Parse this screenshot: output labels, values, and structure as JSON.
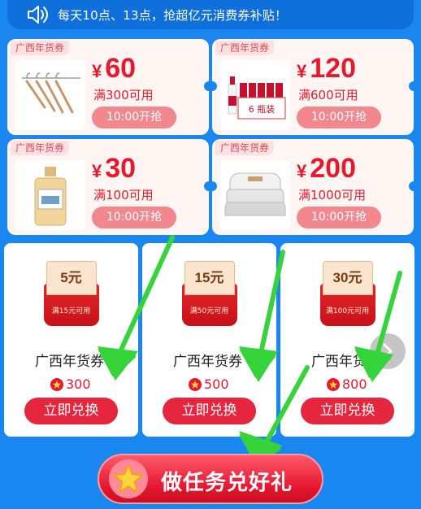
{
  "notice": {
    "icon": "speaker-icon",
    "text": "每天10点、13点，抢超亿元消费券补贴！"
  },
  "coupons": [
    {
      "tag": "广西年货券",
      "currency": "¥",
      "amount": "60",
      "condition": "满300可用",
      "button": "10:00开抢",
      "image": "clothes-hanger-icon"
    },
    {
      "tag": "广西年货券",
      "currency": "¥",
      "amount": "120",
      "condition": "满600可用",
      "button": "10:00开抢",
      "image": "liquor-bottles-icon"
    },
    {
      "tag": "广西年货券",
      "currency": "¥",
      "amount": "30",
      "condition": "满100可用",
      "button": "10:00开抢",
      "image": "whisky-bottle-icon"
    },
    {
      "tag": "广西年货券",
      "currency": "¥",
      "amount": "200",
      "condition": "满1000可用",
      "button": "10:00开抢",
      "image": "quilt-bedding-icon"
    }
  ],
  "exchange": [
    {
      "voucher_amount": "5元",
      "voucher_condition": "满15元可用",
      "name": "广西年货券",
      "points": "300",
      "button": "立即兑换"
    },
    {
      "voucher_amount": "15元",
      "voucher_condition": "满50元可用",
      "name": "广西年货券",
      "points": "500",
      "button": "立即兑换"
    },
    {
      "voucher_amount": "30元",
      "voucher_condition": "满100元可用",
      "name": "广西年货券",
      "points": "800",
      "button": "立即兑换"
    }
  ],
  "cta": {
    "label": "做任务兑好礼",
    "icon": "star-icon"
  },
  "colors": {
    "background": "#1a86f0",
    "accent_red": "#e8192c",
    "arrow_green": "#35d43a"
  }
}
